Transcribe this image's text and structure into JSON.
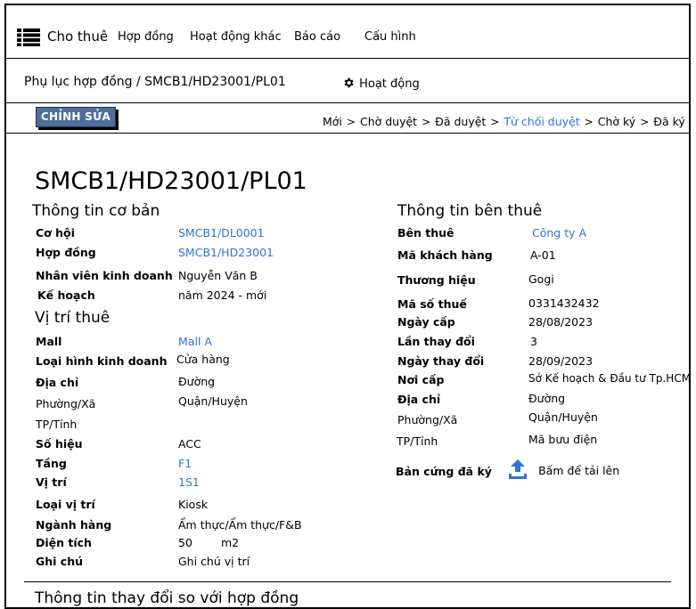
{
  "nav": {
    "brand": "Cho thuê",
    "items": [
      "Hợp đồng",
      "Hoạt động khác",
      "Báo cáo",
      "Cấu hình"
    ]
  },
  "header": {
    "breadcrumb": "Phụ lục hợp đồng / SMCB1/HD23001/PL01",
    "activity_label": "Hoạt động"
  },
  "toolbar": {
    "edit_label": "CHỈNH SỬA",
    "steps": [
      "Mới",
      "Chờ duyệt",
      "Đã duyệt",
      "Từ chối duyệt",
      "Chờ ký",
      "Đã ký"
    ],
    "active_step": "Từ chối duyệt"
  },
  "page": {
    "title": "SMCB1/HD23001/PL01"
  },
  "basic": {
    "heading": "Thông tin cơ bản",
    "rows": [
      {
        "label": "Cơ hội",
        "value": "SMCB1/DL0001"
      },
      {
        "label": "Hợp đồng",
        "value": "SMCB1/HD23001"
      },
      {
        "label": "Nhân viên kinh doanh",
        "value": "Nguyễn Văn B"
      },
      {
        "label": "Kế hoạch",
        "value": "năm 2024 - mới"
      }
    ]
  },
  "location": {
    "heading": "Vị trí thuê",
    "rows": [
      {
        "label": "Mall",
        "value": "Mall A"
      },
      {
        "label": "Loại hình kinh doanh",
        "value": "Cửa hàng"
      },
      {
        "label": "Địa chỉ",
        "value": "Đường"
      },
      {
        "label": "Phường/Xã",
        "value": "Quận/Huyện"
      },
      {
        "label": "TP/Tỉnh",
        "value": ""
      },
      {
        "label": "Số hiệu",
        "value": "ACC"
      },
      {
        "label": "Tầng",
        "value": "F1"
      },
      {
        "label": "Vị trí",
        "value": "1S1"
      },
      {
        "label": "Loại vị trí",
        "value": "Kiosk"
      },
      {
        "label": "Ngành hàng",
        "value": "Ẩm thực/Ẩm thực/F&B"
      },
      {
        "label": "Diện tích",
        "value": "50"
      },
      {
        "label": "Ghi chú",
        "value": "Ghi chú vị trí"
      }
    ],
    "area_unit": "m2"
  },
  "tenant": {
    "heading": "Thông tin bên thuê",
    "rows": [
      {
        "label": "Bên thuê",
        "value": "Công ty A"
      },
      {
        "label": "Mã khách hàng",
        "value": "A-01"
      },
      {
        "label": "Thương hiệu",
        "value": "Gogi"
      },
      {
        "label": "Mã số thuế",
        "value": "0331432432"
      },
      {
        "label": "Ngày cấp",
        "value": "28/08/2023"
      },
      {
        "label": "Lần thay đổi",
        "value": "3"
      },
      {
        "label": "Ngày thay đổi",
        "value": "28/09/2023"
      },
      {
        "label": "Nơi cấp",
        "value": "Sở Kế hoạch & Đầu tư Tp.HCM"
      },
      {
        "label": "Địa chỉ",
        "value": "Đường"
      },
      {
        "label": "Phường/Xã",
        "value": "Quận/Huyện"
      },
      {
        "label": "TP/Tỉnh",
        "value": "Mã bưu điện"
      }
    ],
    "signed_label": "Bản cứng đã ký",
    "upload_label": "Bấm để tải lên"
  },
  "footer_heading": "Thông tin thay đổi so với hợp đồng"
}
